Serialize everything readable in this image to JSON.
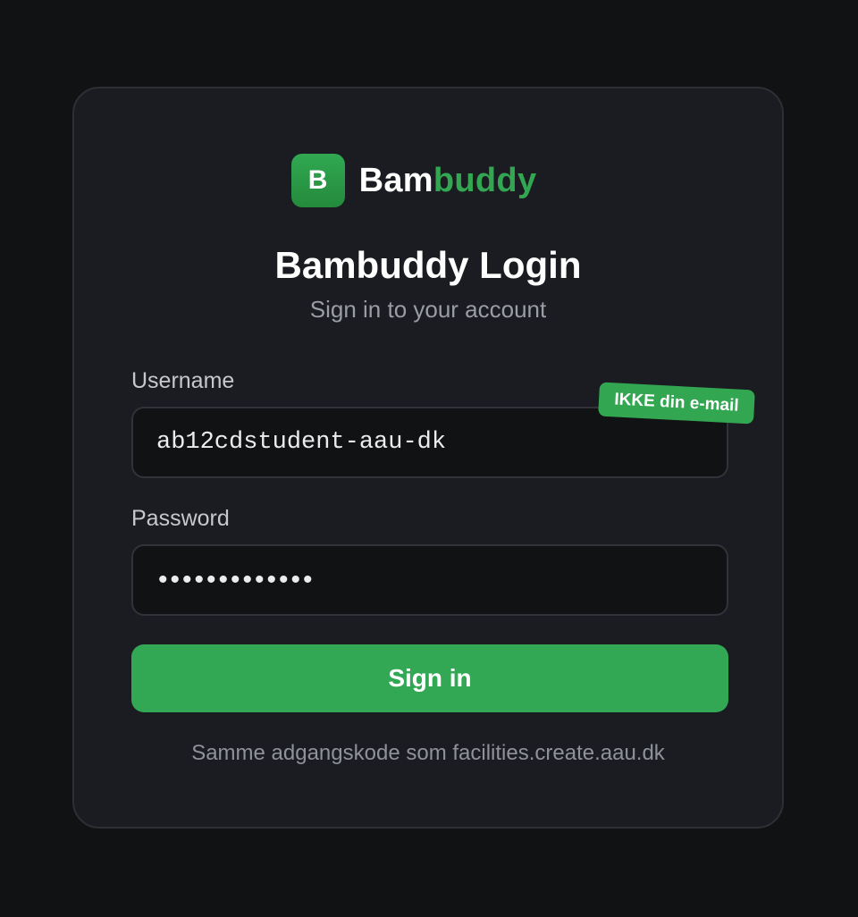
{
  "brand": {
    "logo_letter": "B",
    "name_part1": "Bam",
    "name_part2": "buddy",
    "accent_color": "#33a652"
  },
  "login": {
    "title": "Bambuddy Login",
    "subtitle": "Sign in to your account",
    "username": {
      "label": "Username",
      "value": "ab12cdstudent-aau-dk",
      "badge": "IKKE din e-mail"
    },
    "password": {
      "label": "Password",
      "masked_value": "•••••••••••••"
    },
    "submit_label": "Sign in",
    "hint": "Samme adgangskode som facilities.create.aau.dk"
  },
  "colors": {
    "background": "#111214",
    "card": "#1a1c22",
    "button": "#33a854"
  }
}
